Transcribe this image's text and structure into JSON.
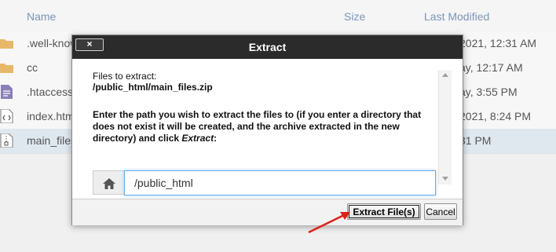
{
  "file_list": {
    "columns": {
      "name": "Name",
      "size": "Size",
      "last_modified": "Last Modified"
    },
    "rows": [
      {
        "name": ".well-known",
        "modified": "2021, 12:31 AM",
        "icon": "folder-icon",
        "selected": false
      },
      {
        "name": "cc",
        "modified": "ay, 12:17 AM",
        "icon": "folder-icon",
        "selected": false
      },
      {
        "name": ".htaccess",
        "modified": "ay, 3:55 PM",
        "icon": "text-file-icon",
        "selected": false
      },
      {
        "name": "index.html",
        "modified": "2021, 8:24 PM",
        "icon": "code-file-icon",
        "selected": false
      },
      {
        "name": "main_files.zip",
        "modified": "31 PM",
        "icon": "zip-file-icon",
        "selected": true
      }
    ]
  },
  "dialog": {
    "title": "Extract",
    "close_label": "×",
    "files_label": "Files to extract:",
    "files_path": "/public_html/main_files.zip",
    "instruction_prefix": "Enter the path you wish to extract the files to (if you enter a directory that does not exist it will be created, and the archive extracted in the new directory) and click ",
    "instruction_action": "Extract",
    "instruction_suffix": ":",
    "path_value": "/public_html",
    "extract_button": "Extract File(s)",
    "cancel_button": "Cancel"
  },
  "colors": {
    "titlebar": "#2b2b2b",
    "header_text": "#7c96b8",
    "folder": "#e8b86a",
    "annotation_arrow": "#e0201c"
  }
}
